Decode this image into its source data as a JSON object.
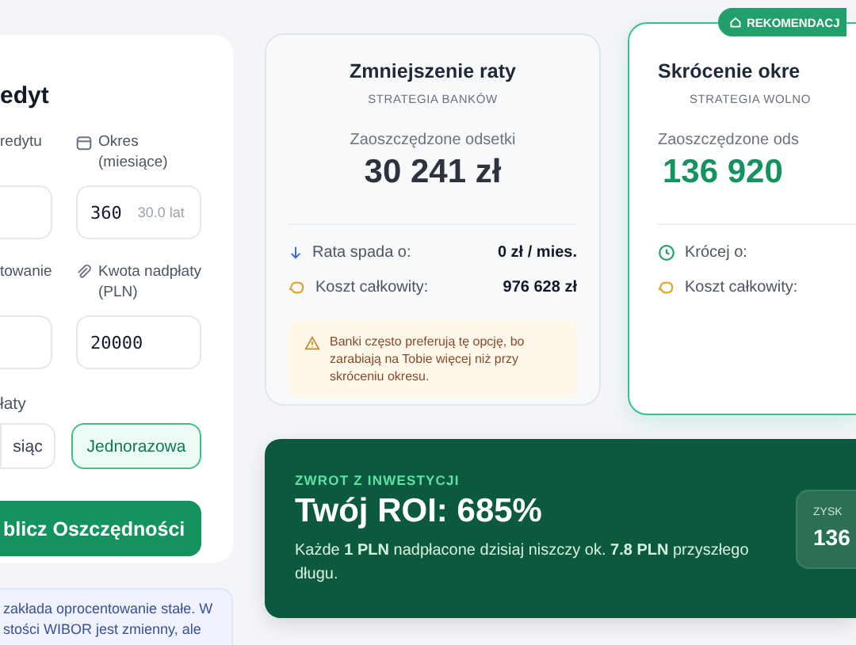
{
  "form": {
    "title": "edyt",
    "fields": [
      {
        "label": "redytu"
      },
      {
        "label": "Okres (miesiące)",
        "value": "360",
        "suffix": "30.0 lat"
      },
      {
        "label": "towanie"
      },
      {
        "label": "Kwota nadpłaty (PLN)",
        "value": "20000"
      }
    ],
    "payment": {
      "label": "łaty",
      "options": [
        {
          "label": "siąc",
          "selected": false
        },
        {
          "label": "Jednorazowa",
          "selected": true
        }
      ]
    },
    "button": "blicz Oszczędności"
  },
  "info_note": {
    "lines": [
      "zakłada oprocentowanie stałe. W",
      "stości WIBOR jest zmienny, ale"
    ]
  },
  "cards": [
    {
      "title": "Zmniejszenie raty",
      "subtitle": "STRATEGIA BANKÓW",
      "metric_label": "Zaoszczędzone odsetki",
      "metric": "30 241 zł",
      "recommended": false,
      "rows": [
        {
          "kind": "decrease",
          "label": "Rata spada o:",
          "value": "0 zł / mies."
        },
        {
          "kind": "cost",
          "label": "Koszt całkowity:",
          "value": "976 628 zł"
        }
      ],
      "note": "Banki często preferują tę opcję, bo zarabiają na Tobie więcej niż przy skróceniu okresu."
    },
    {
      "badge": "REKOMENDACJ",
      "title": "Skrócenie okre",
      "subtitle": "STRATEGIA WOLNO",
      "metric_label": "Zaoszczędzone ods",
      "metric": "136 920",
      "recommended": true,
      "rows": [
        {
          "kind": "shorter",
          "label": "Krócej o:"
        },
        {
          "kind": "cost",
          "label": "Koszt całkowity:"
        }
      ]
    }
  ],
  "roi": {
    "eyebrow": "ZWROT Z INWESTYCJI",
    "title": "Twój ROI: 685%",
    "text": "Każde **1 PLN** nadpłacone dzisiaj niszczy ok. **7.8 PLN** przyszłego długu.",
    "side_label": "ZYSK",
    "side_value": "136"
  }
}
